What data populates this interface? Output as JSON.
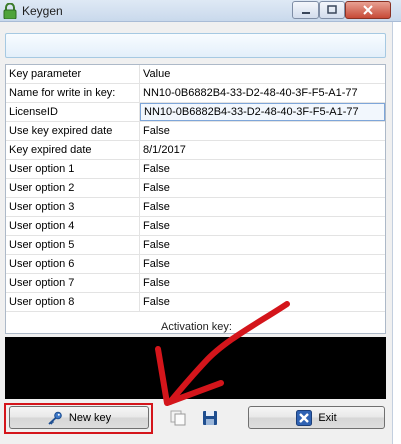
{
  "window": {
    "title": "Keygen"
  },
  "grid": {
    "headers": {
      "key": "Key parameter",
      "value": "Value"
    },
    "rows": [
      {
        "key": "Name for write in key:",
        "value": "NN10-0B6882B4-33-D2-48-40-3F-F5-A1-77"
      },
      {
        "key": "LicenseID",
        "value": "NN10-0B6882B4-33-D2-48-40-3F-F5-A1-77"
      },
      {
        "key": "Use key expired date",
        "value": "False"
      },
      {
        "key": "Key expired date",
        "value": "8/1/2017"
      },
      {
        "key": "User option 1",
        "value": "False"
      },
      {
        "key": "User option 2",
        "value": "False"
      },
      {
        "key": "User option 3",
        "value": "False"
      },
      {
        "key": "User option 4",
        "value": "False"
      },
      {
        "key": "User option 5",
        "value": "False"
      },
      {
        "key": "User option 6",
        "value": "False"
      },
      {
        "key": "User option 7",
        "value": "False"
      },
      {
        "key": "User option 8",
        "value": "False"
      }
    ]
  },
  "activation": {
    "label": "Activation key:"
  },
  "buttons": {
    "new_key": "New key",
    "exit": "Exit"
  },
  "colors": {
    "annotation": "#d4151b",
    "titlebar": "#dfe9f5",
    "selection": "#7ea6d9"
  },
  "icons": [
    "lock-icon",
    "minimize-icon",
    "maximize-icon",
    "close-icon",
    "key-icon",
    "copy-icon",
    "save-icon",
    "exit-x-icon"
  ]
}
